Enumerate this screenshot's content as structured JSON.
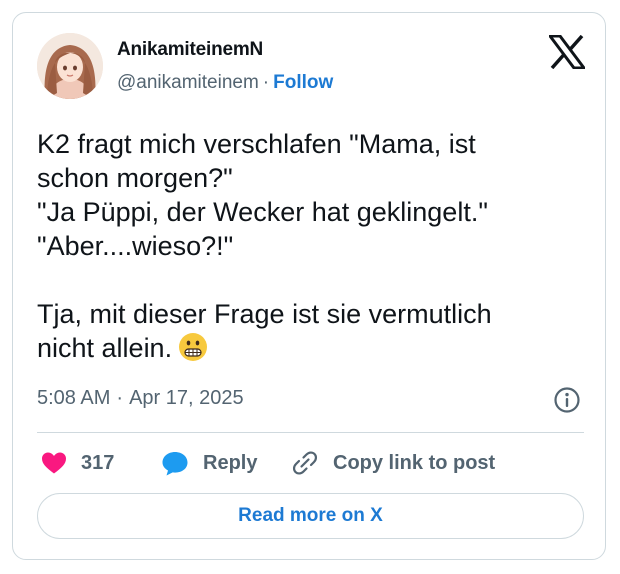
{
  "author": {
    "display_name": "AnikamiteinemN",
    "handle": "@anikamiteinem",
    "separator": "·",
    "follow_label": "Follow"
  },
  "tweet": {
    "text": "K2 fragt mich verschlafen \"Mama, ist\nschon morgen?\"\n\"Ja Püppi, der Wecker hat geklingelt.\"\n\"Aber....wieso?!\"\n\nTja, mit dieser Frage ist sie vermutlich\nnicht allein.",
    "emoji": "grimacing-face"
  },
  "meta": {
    "time": "5:08 AM",
    "separator": "·",
    "date": "Apr 17, 2025"
  },
  "actions": {
    "like_count": "317",
    "reply_label": "Reply",
    "copy_link_label": "Copy link to post"
  },
  "read_more_label": "Read more on X",
  "icons": {
    "brand": "x-logo-icon",
    "info": "info-icon",
    "like": "heart-icon",
    "reply": "speech-bubble-icon",
    "copy": "link-icon"
  },
  "colors": {
    "link": "#1d7ad3",
    "heart": "#f91880",
    "reply_bubble": "#1d9bf0",
    "muted_text": "#536471",
    "border": "#cfd9de"
  }
}
